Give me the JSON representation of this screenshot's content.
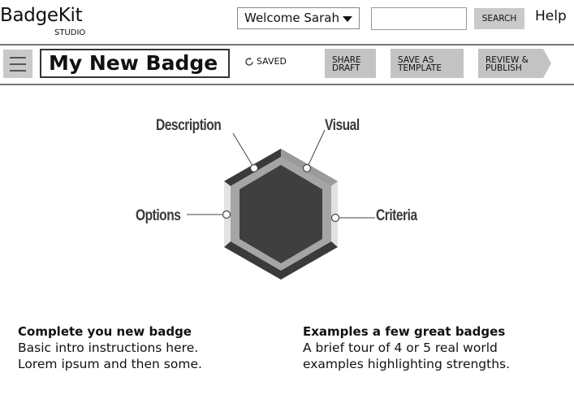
{
  "header": {
    "brand": "BadgeKit",
    "brand_sub": "STUDIO",
    "welcome": "Welcome Sarah",
    "search_placeholder": "",
    "search_button": "SEARCH",
    "help": "Help"
  },
  "toolbar": {
    "badge_title": "My New Badge",
    "saved_status": "SAVED",
    "share_line1": "SHARE",
    "share_line2": "DRAFT",
    "template_line1": "SAVE AS",
    "template_line2": "TEMPLATE",
    "publish_line1": "REVIEW &",
    "publish_line2": "PUBLISH"
  },
  "diagram": {
    "description": "Description",
    "visual": "Visual",
    "options": "Options",
    "criteria": "Criteria"
  },
  "columns": {
    "left_heading": "Complete you new badge",
    "left_line1": "Basic intro instructions here.",
    "left_line2": "Lorem ipsum and then some.",
    "right_heading": "Examples a few great badges",
    "right_line1": "A brief tour of 4 or 5 real world",
    "right_line2": "examples highlighting strengths."
  }
}
